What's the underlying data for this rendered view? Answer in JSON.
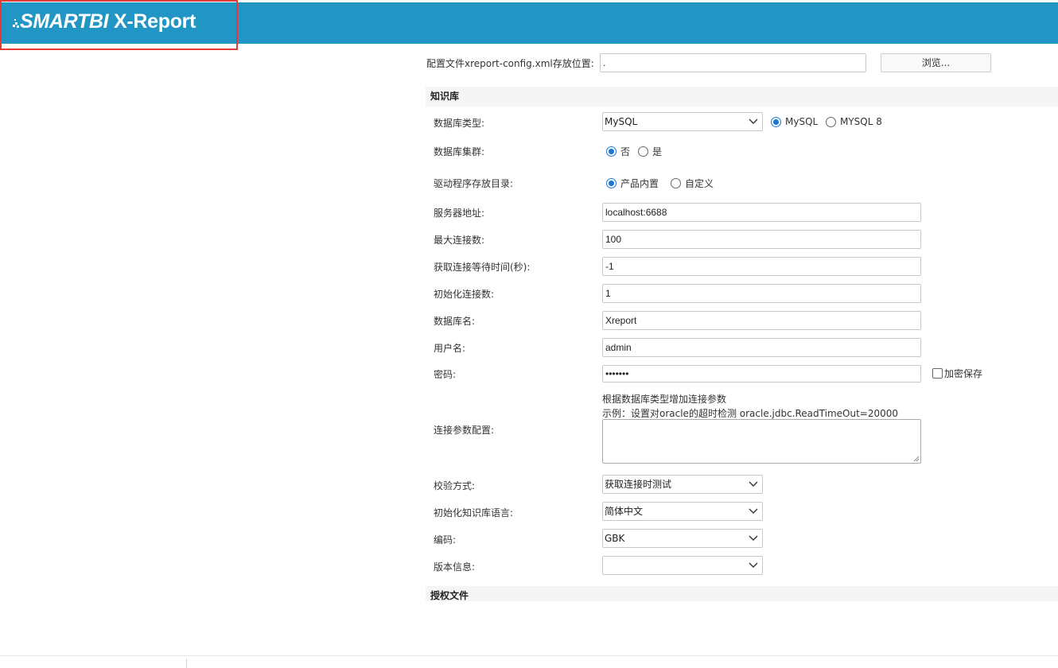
{
  "header": {
    "logo_brand": "SMARTBI",
    "logo_product": "X-Report"
  },
  "config": {
    "label": "配置文件xreport-config.xml存放位置:",
    "value": ".",
    "browse_label": "浏览..."
  },
  "knowledge_base": {
    "section_title": "知识库",
    "db_type": {
      "label": "数据库类型:",
      "selected": "MySQL",
      "radio_options": [
        "MySQL",
        "MYSQL 8"
      ],
      "radio_selected": "MySQL"
    },
    "db_cluster": {
      "label": "数据库集群:",
      "options": [
        "否",
        "是"
      ],
      "selected": "否"
    },
    "driver_dir": {
      "label": "驱动程序存放目录:",
      "options": [
        "产品内置",
        "自定义"
      ],
      "selected": "产品内置"
    },
    "server_address": {
      "label": "服务器地址:",
      "value": "localhost:6688"
    },
    "max_connections": {
      "label": "最大连接数:",
      "value": "100"
    },
    "wait_time": {
      "label": "获取连接等待时间(秒):",
      "value": "-1"
    },
    "init_connections": {
      "label": "初始化连接数:",
      "value": "1"
    },
    "db_name": {
      "label": "数据库名:",
      "value": "Xreport"
    },
    "username": {
      "label": "用户名:",
      "value": "admin"
    },
    "password": {
      "label": "密码:",
      "value": "•••••••",
      "encrypt_label": "加密保存",
      "encrypt_checked": false
    },
    "conn_params": {
      "label": "连接参数配置:",
      "hint1": "根据数据库类型增加连接参数",
      "hint2": "示例：设置对oracle的超时检测 oracle.jdbc.ReadTimeOut=20000",
      "value": ""
    },
    "validation": {
      "label": "校验方式:",
      "selected": "获取连接时测试"
    },
    "init_language": {
      "label": "初始化知识库语言:",
      "selected": "简体中文"
    },
    "encoding": {
      "label": "编码:",
      "selected": "GBK"
    },
    "version": {
      "label": "版本信息:",
      "selected": ""
    }
  },
  "license": {
    "section_title": "授权文件"
  }
}
